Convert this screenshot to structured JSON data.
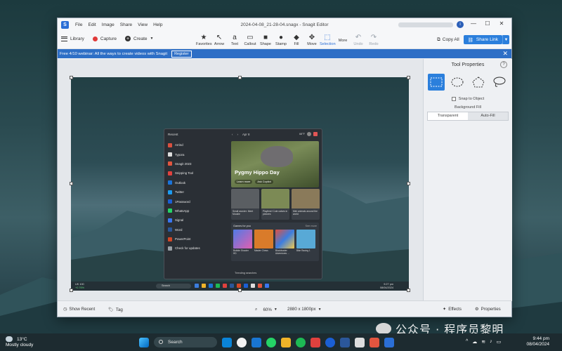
{
  "window": {
    "title": "2024-04-08_21-28-04.snagx - Snagit Editor",
    "menu": [
      "File",
      "Edit",
      "Image",
      "Share",
      "View",
      "Help"
    ],
    "logo_letter": "S",
    "account_icon": "i",
    "controls": [
      "—",
      "☐",
      "✕"
    ]
  },
  "toolbar": {
    "library": "Library",
    "capture": "Capture",
    "create": "Create",
    "tools": [
      {
        "glyph": "★",
        "label": "Favorites",
        "icon": "star-icon"
      },
      {
        "glyph": "↖",
        "label": "Arrow",
        "icon": "arrow-icon"
      },
      {
        "glyph": "a",
        "label": "Text",
        "icon": "text-icon"
      },
      {
        "glyph": "▭",
        "label": "Callout",
        "icon": "callout-icon"
      },
      {
        "glyph": "■",
        "label": "Shape",
        "icon": "shape-icon"
      },
      {
        "glyph": "●",
        "label": "Stamp",
        "icon": "stamp-icon"
      },
      {
        "glyph": "◆",
        "label": "Fill",
        "icon": "fill-icon"
      },
      {
        "glyph": "✥",
        "label": "Move",
        "icon": "move-icon"
      },
      {
        "glyph": "⬚",
        "label": "Selection",
        "icon": "selection-icon"
      },
      {
        "glyph": "",
        "label": "More",
        "icon": "more-icon"
      },
      {
        "glyph": "↶",
        "label": "Undo",
        "icon": "undo-icon"
      },
      {
        "glyph": "↷",
        "label": "Redo",
        "icon": "redo-icon"
      }
    ],
    "copy_all": "Copy All",
    "share_link": "Share Link"
  },
  "banner": {
    "text": "Free 4/10 webinar: All the ways to create videos with Snagit",
    "register": "Register"
  },
  "capture": {
    "recent_header": "Recent",
    "apps": [
      "Arrind",
      "Typora",
      "Snagit 2023",
      "Snipping Tool",
      "Outlook",
      "Twitter",
      "1Password",
      "WhatsApp",
      "Signal",
      "Word",
      "PowerPoint",
      "Check for updates"
    ],
    "date": "Apr 8",
    "temp": "68°F",
    "hero_title": "Pygmy Hippo Day",
    "hero_learn": "Learn more",
    "hero_copilot": "Ask Copilot",
    "cards": [
      "Small wonder: Meet Moodie",
      "Playtime! Cute calves in pictures",
      "Mini animals around the world"
    ],
    "games_header": "Games for you",
    "see_more": "See more",
    "games": [
      "Bubble Shooter HD",
      "Master Chess",
      "Blockbuster Adventures ...",
      "Bike Racing 1"
    ],
    "trending": "Trending searches",
    "inner_weather": "UK 100",
    "inner_weather_change": "+0.76%",
    "inner_search": "Search",
    "inner_time": "9:27 pm",
    "inner_date": "08/04/2024"
  },
  "properties": {
    "title": "Tool Properties",
    "help": "?",
    "snap": "Snap to Object",
    "background_fill": "Background Fill",
    "transparent": "Transparent",
    "auto_fill": "Auto-Fill"
  },
  "statusbar": {
    "show_recent": "Show Recent",
    "tag": "Tag",
    "zoom": "60%",
    "size": "2880 x 1800px",
    "effects": "Effects",
    "properties": "Properties"
  },
  "taskbar": {
    "temp": "13°C",
    "weather": "Mostly cloudy",
    "search": "Search",
    "time": "9:44 pm",
    "date": "08/04/2024",
    "watermark": "公众号 · 程序员黎明"
  },
  "colors": {
    "accent": "#2b7fdc",
    "banner": "#2e6fc6",
    "desktop": "#2d4a52"
  }
}
